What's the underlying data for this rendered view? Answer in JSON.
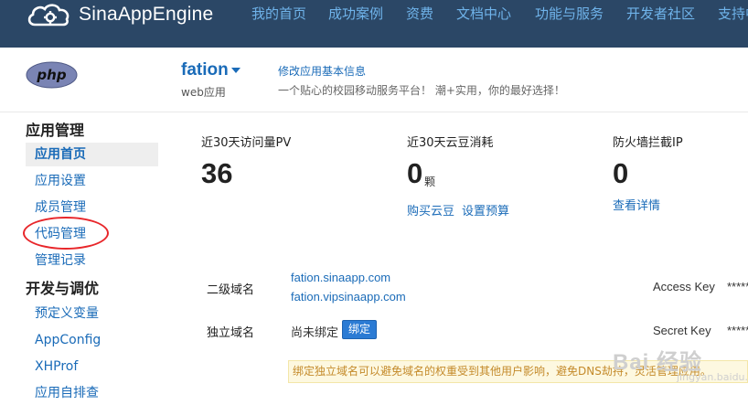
{
  "header": {
    "brand": "SinaAppEngine",
    "nav": [
      "我的首页",
      "成功案例",
      "资费",
      "文档中心",
      "功能与服务",
      "开发者社区",
      "支持中"
    ]
  },
  "app": {
    "logo_text": "php",
    "name": "fation",
    "type": "web应用",
    "edit_link": "修改应用基本信息",
    "slogan": "一个贴心的校园移动服务平台！ 潮+实用，你的最好选择！"
  },
  "sidebar": {
    "sections": [
      {
        "title": "应用管理",
        "items": [
          "应用首页",
          "应用设置",
          "成员管理",
          "代码管理",
          "管理记录"
        ]
      },
      {
        "title": "开发与调优",
        "items": [
          "预定义变量",
          "AppConfig",
          "XHProf",
          "应用自排查"
        ]
      }
    ],
    "active": "应用首页",
    "highlighted": "代码管理"
  },
  "stats": [
    {
      "label": "近30天访问量PV",
      "value": "36",
      "unit": "",
      "links": []
    },
    {
      "label": "近30天云豆消耗",
      "value": "0",
      "unit": "颗",
      "links": [
        "购买云豆",
        "设置预算"
      ]
    },
    {
      "label": "防火墙拦截IP",
      "value": "0",
      "unit": "",
      "links": [
        "查看详情"
      ]
    }
  ],
  "domains": {
    "secondary_label": "二级域名",
    "secondary": [
      "fation.sinaapp.com",
      "fation.vipsinaapp.com"
    ],
    "independent_label": "独立域名",
    "independent_status": "尚未绑定",
    "bind_button": "绑定",
    "notice": "绑定独立域名可以避免域名的权重受到其他用户影响，避免DNS劫持，灵活管理应用。"
  },
  "keys": {
    "access_label": "Access Key",
    "access_value": "*****",
    "secret_label": "Secret Key",
    "secret_value": "*****"
  },
  "watermark": {
    "text": "Bai 经验",
    "sub": "jingyan.baidu.com"
  },
  "colors": {
    "nav_bg": "#2b4766",
    "link": "#1a6bb8",
    "highlight_ring": "#e8262a",
    "button": "#2b7bd4"
  }
}
